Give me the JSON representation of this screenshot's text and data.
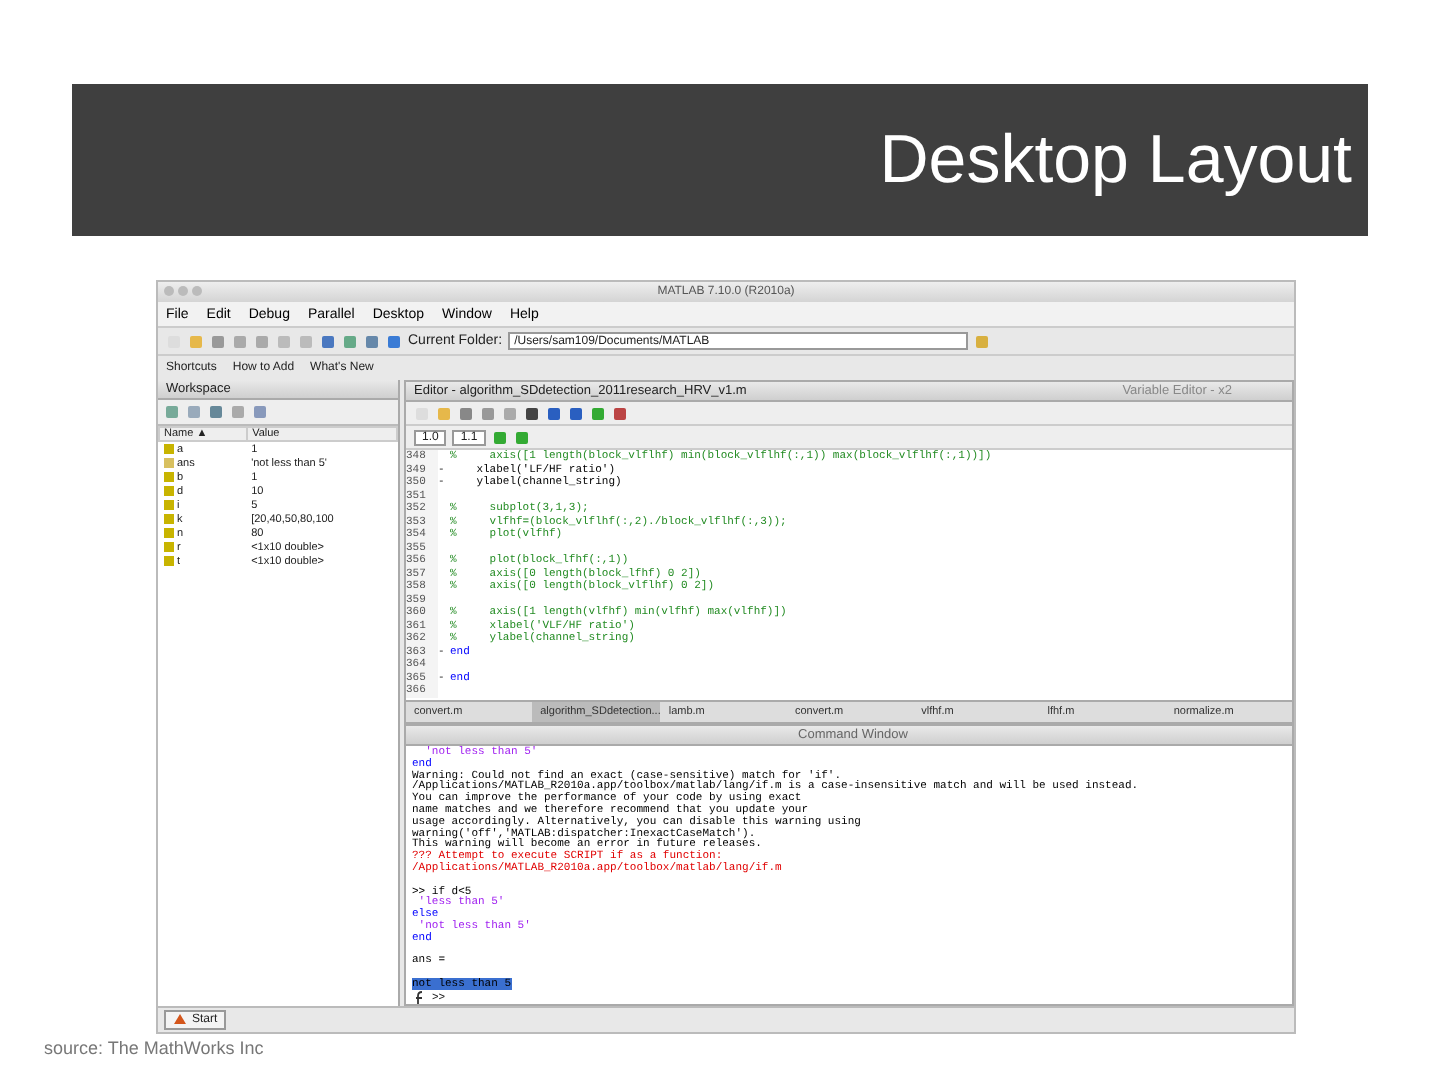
{
  "slide": {
    "title": "Desktop Layout",
    "source": "source: The MathWorks Inc"
  },
  "window": {
    "title": "MATLAB 7.10.0 (R2010a)"
  },
  "menu": [
    "File",
    "Edit",
    "Debug",
    "Parallel",
    "Desktop",
    "Window",
    "Help"
  ],
  "toolbar": {
    "folder_label": "Current Folder:",
    "folder": "/Users/sam109/Documents/MATLAB"
  },
  "shortcuts": [
    "Shortcuts",
    "How to Add",
    "What's New"
  ],
  "workspace": {
    "title": "Workspace",
    "columns": [
      "Name ▲",
      "Value"
    ],
    "rows": [
      {
        "name": "a",
        "value": "1",
        "kind": "num"
      },
      {
        "name": "ans",
        "value": "'not less than 5'",
        "kind": "str"
      },
      {
        "name": "b",
        "value": "1",
        "kind": "num"
      },
      {
        "name": "d",
        "value": "10",
        "kind": "num"
      },
      {
        "name": "i",
        "value": "5",
        "kind": "num"
      },
      {
        "name": "k",
        "value": "[20,40,50,80,100",
        "kind": "num"
      },
      {
        "name": "n",
        "value": "80",
        "kind": "num"
      },
      {
        "name": "r",
        "value": "<1x10 double>",
        "kind": "num"
      },
      {
        "name": "t",
        "value": "<1x10 double>",
        "kind": "num"
      }
    ]
  },
  "editor": {
    "title": "Editor - algorithm_SDdetection_2011research_HRV_v1.m",
    "variable_editor": "Variable Editor - x2",
    "cell_fields": [
      "1.0",
      "1.1"
    ],
    "lines": [
      {
        "num": "348",
        "text": "%     axis([1 length(block_vlflhf) min(block_vlflhf(:,1)) max(block_vlflhf(:,1))])",
        "kind": "comment"
      },
      {
        "num": "349",
        "marker": "-",
        "text": "    xlabel('LF/HF ratio')",
        "kind": "code"
      },
      {
        "num": "350",
        "marker": "-",
        "text": "    ylabel(channel_string)",
        "kind": "code"
      },
      {
        "num": "351"
      },
      {
        "num": "352",
        "text": "%     subplot(3,1,3);",
        "kind": "comment"
      },
      {
        "num": "353",
        "text": "%     vlfhf=(block_vlflhf(:,2)./block_vlflhf(:,3));",
        "kind": "comment"
      },
      {
        "num": "354",
        "text": "%     plot(vlfhf)",
        "kind": "comment"
      },
      {
        "num": "355"
      },
      {
        "num": "356",
        "text": "%     plot(block_lfhf(:,1))",
        "kind": "comment"
      },
      {
        "num": "357",
        "text": "%     axis([0 length(block_lfhf) 0 2])",
        "kind": "comment"
      },
      {
        "num": "358",
        "text": "%     axis([0 length(block_vlflhf) 0 2])",
        "kind": "comment"
      },
      {
        "num": "359"
      },
      {
        "num": "360",
        "text": "%     axis([1 length(vlfhf) min(vlfhf) max(vlfhf)])",
        "kind": "comment"
      },
      {
        "num": "361",
        "text": "%     xlabel('VLF/HF ratio')",
        "kind": "comment"
      },
      {
        "num": "362",
        "text": "%     ylabel(channel_string)",
        "kind": "comment"
      },
      {
        "num": "363",
        "marker": "-",
        "text": "end",
        "kind": "keyword"
      },
      {
        "num": "364"
      },
      {
        "num": "365",
        "marker": "-",
        "text": "end",
        "kind": "keyword"
      },
      {
        "num": "366"
      }
    ],
    "tabs": [
      {
        "label": "convert.m",
        "selected": false
      },
      {
        "label": "algorithm_SDdetection...",
        "selected": true
      },
      {
        "label": "lamb.m",
        "selected": false
      },
      {
        "label": "convert.m",
        "selected": false
      },
      {
        "label": "vlfhf.m",
        "selected": false
      },
      {
        "label": "lfhf.m",
        "selected": false
      },
      {
        "label": "normalize.m",
        "selected": false
      }
    ]
  },
  "command_window": {
    "title": "Command Window",
    "lines": [
      {
        "text": "  'not less than 5'",
        "kind": "string"
      },
      {
        "text": "end",
        "kind": "keyword"
      },
      {
        "text": "Warning: Could not find an exact (case-sensitive) match for 'if'.",
        "kind": "text"
      },
      {
        "text": "/Applications/MATLAB_R2010a.app/toolbox/matlab/lang/if.m is a case-insensitive match and will be used instead.",
        "kind": "text"
      },
      {
        "text": "You can improve the performance of your code by using exact",
        "kind": "text"
      },
      {
        "text": "name matches and we therefore recommend that you update your",
        "kind": "text"
      },
      {
        "text": "usage accordingly. Alternatively, you can disable this warning using",
        "kind": "text"
      },
      {
        "text": "warning('off','MATLAB:dispatcher:InexactCaseMatch').",
        "kind": "text"
      },
      {
        "text": "This warning will become an error in future releases.",
        "kind": "text"
      },
      {
        "text": "??? Attempt to execute SCRIPT if as a function:",
        "kind": "error"
      },
      {
        "text": "/Applications/MATLAB_R2010a.app/toolbox/matlab/lang/if.m",
        "kind": "error"
      },
      {
        "kind": "blank"
      },
      {
        "text": ">> if d<5",
        "kind": "text"
      },
      {
        "text": " 'less than 5'",
        "kind": "string"
      },
      {
        "text": "else",
        "kind": "keyword"
      },
      {
        "text": " 'not less than 5'",
        "kind": "string"
      },
      {
        "text": "end",
        "kind": "keyword"
      },
      {
        "kind": "blank"
      },
      {
        "text": "ans =",
        "kind": "text"
      },
      {
        "kind": "blank"
      },
      {
        "text": "not less than 5",
        "kind": "selected"
      }
    ],
    "prompt": ">>"
  },
  "start": "Start"
}
